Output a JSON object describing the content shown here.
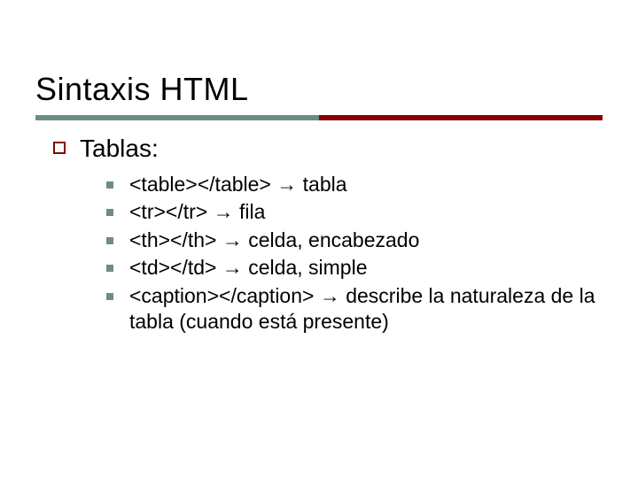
{
  "title": "Sintaxis HTML",
  "section": {
    "heading": "Tablas:",
    "items": [
      "<table></table> → tabla",
      "<tr></tr> → fila",
      "<th></th> → celda, encabezado",
      "<td></td> → celda, simple",
      "<caption></caption> → describe la naturaleza de la tabla (cuando está presente)"
    ]
  }
}
